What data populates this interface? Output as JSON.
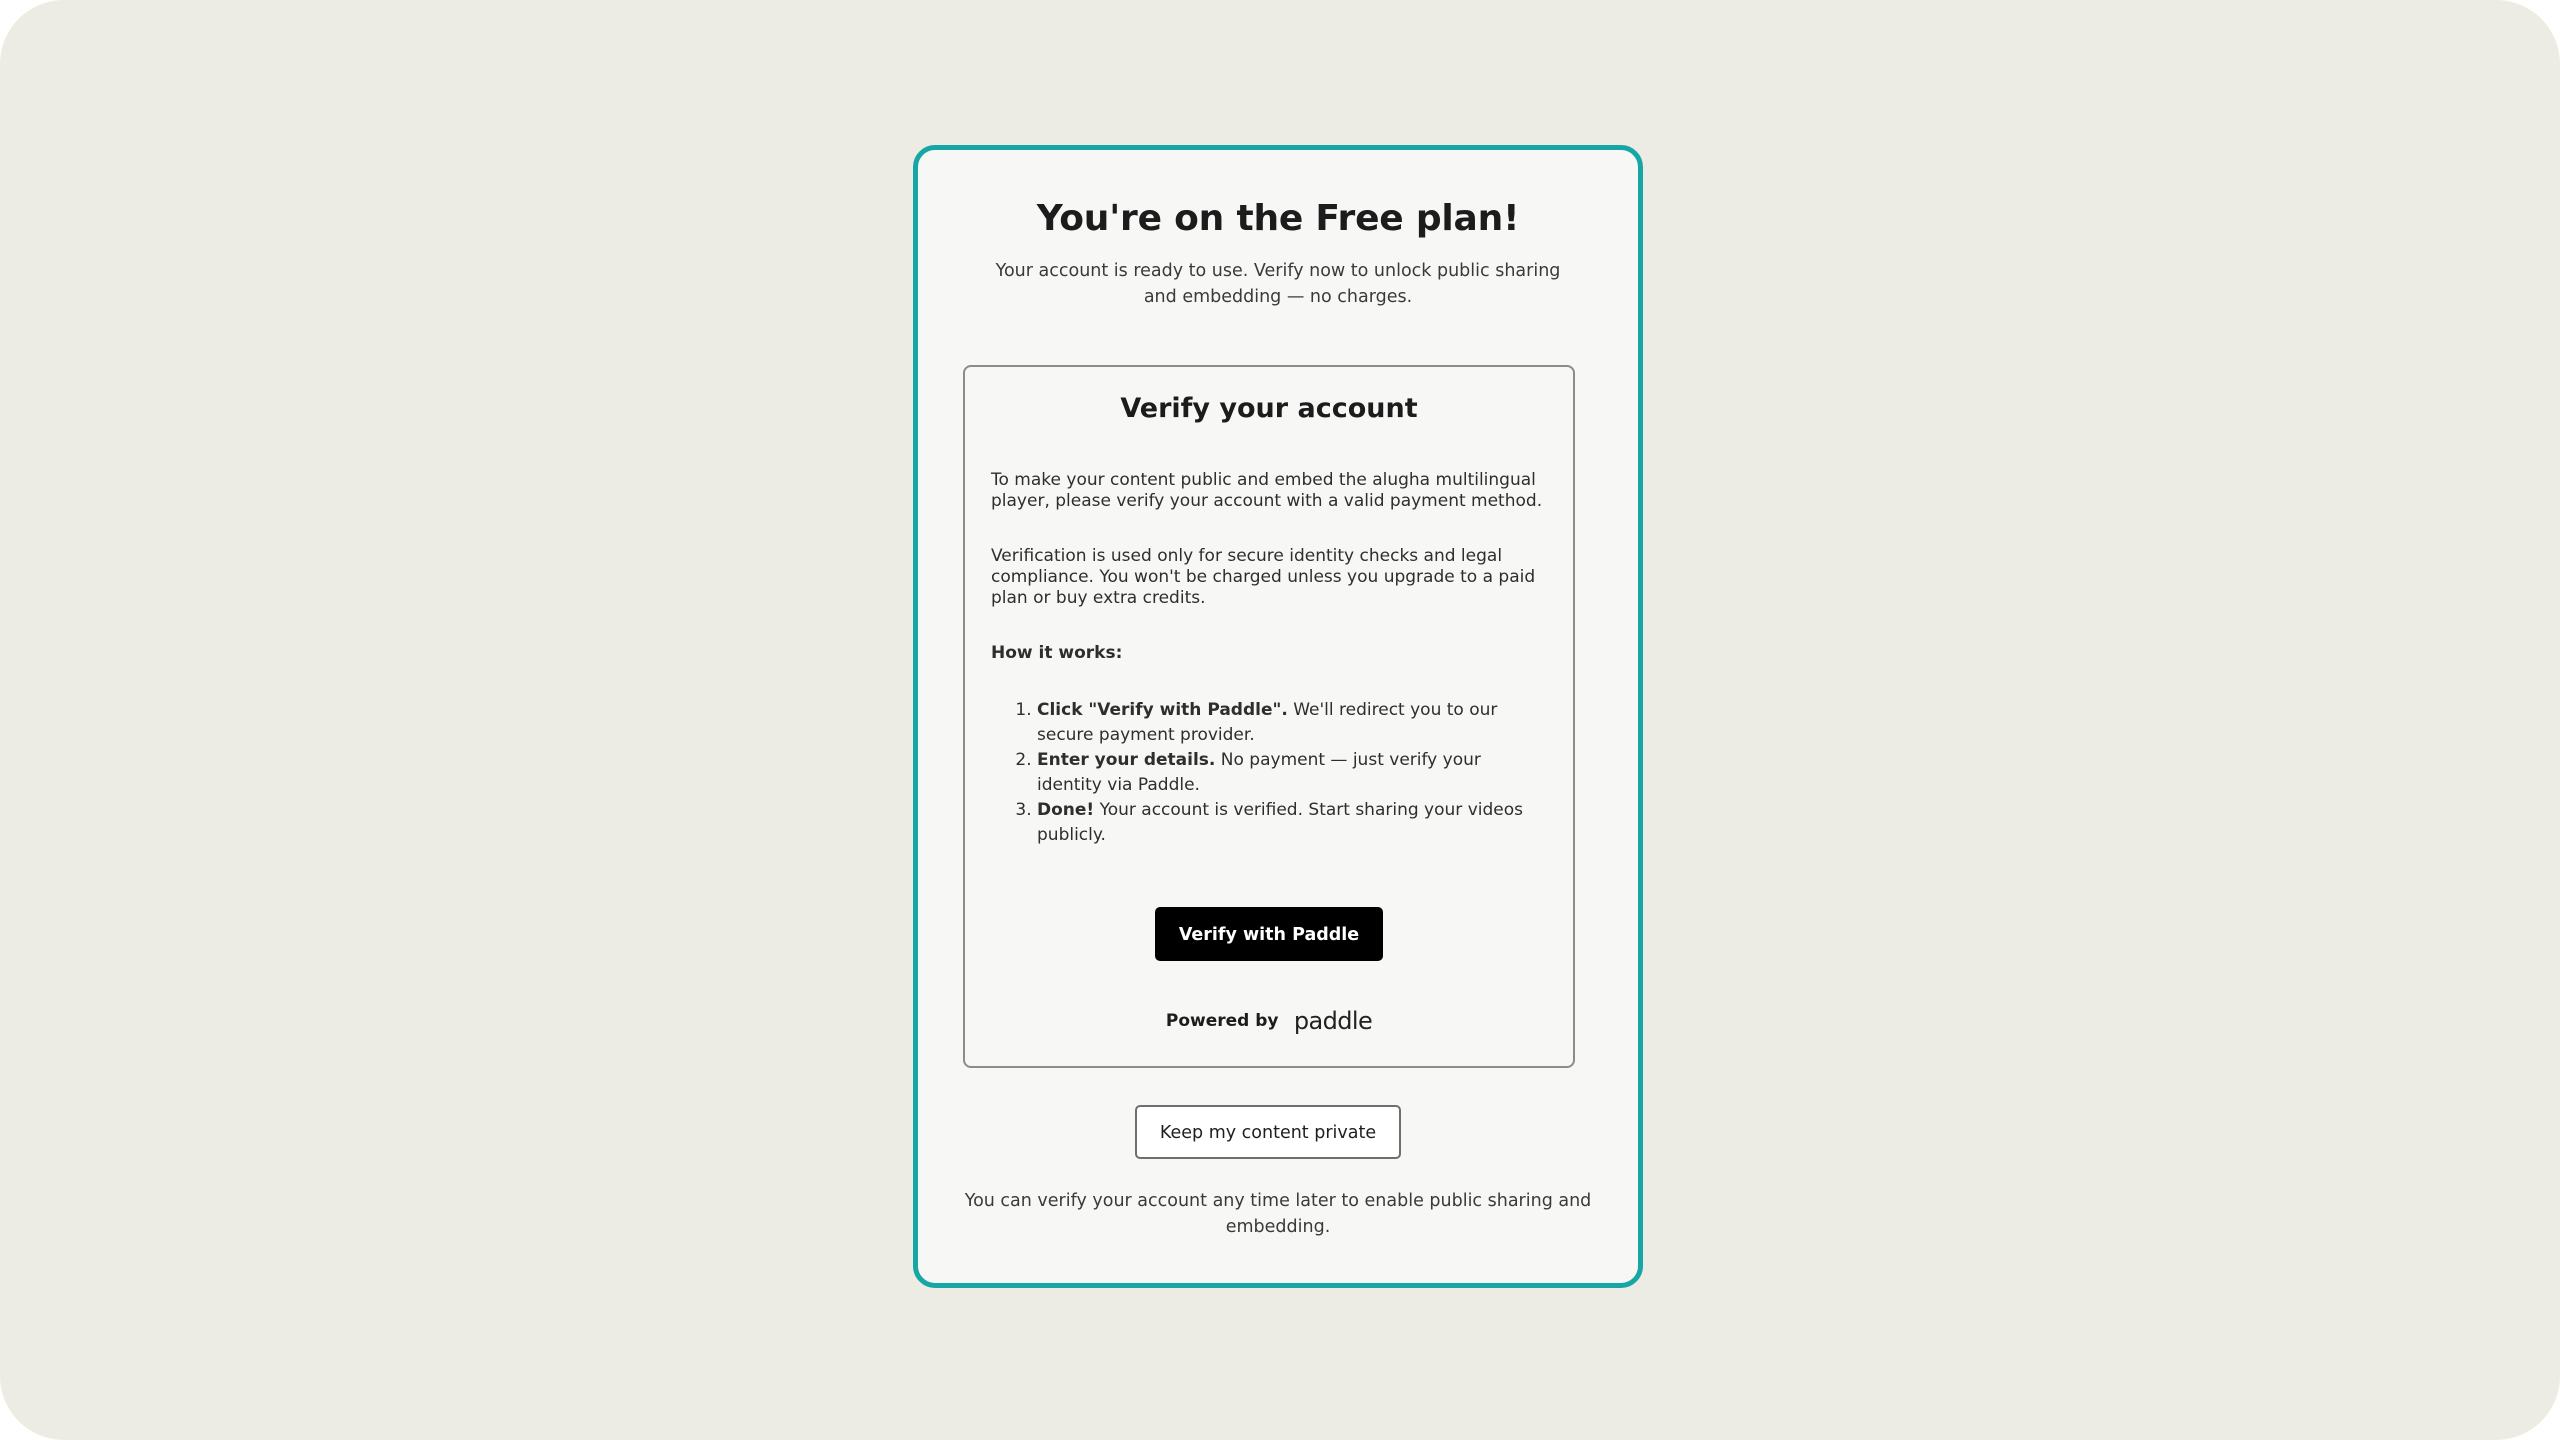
{
  "modal": {
    "title": "You're on the Free plan!",
    "subtitle": "Your account is ready to use. Verify now to unlock public sharing and embedding — no charges."
  },
  "verify_card": {
    "title": "Verify your account",
    "paragraph_1": "To make your content public and embed the alugha multilingual player, please verify your account with a valid payment method.",
    "paragraph_2": "Verification is used only for secure identity checks and legal compliance. You won't be charged unless you upgrade to a paid plan or buy extra credits.",
    "how_it_works_label": "How it works:",
    "steps": [
      {
        "bold": "Click \"Verify with Paddle\".",
        "text": " We'll redirect you to our secure payment provider."
      },
      {
        "bold": "Enter your details.",
        "text": " No payment — just verify your identity via Paddle."
      },
      {
        "bold": "Done!",
        "text": " Your account is verified. Start sharing your videos publicly."
      }
    ],
    "verify_button_label": "Verify with Paddle",
    "powered_by_label": "Powered by",
    "paddle_logo_text": "paddle"
  },
  "keep_private_button_label": "Keep my content private",
  "footer_note": "You can verify your account any time later to enable public sharing and embedding.",
  "colors": {
    "background": "#ecebe4",
    "modal_border": "#17a6a6",
    "primary_button": "#000000"
  }
}
